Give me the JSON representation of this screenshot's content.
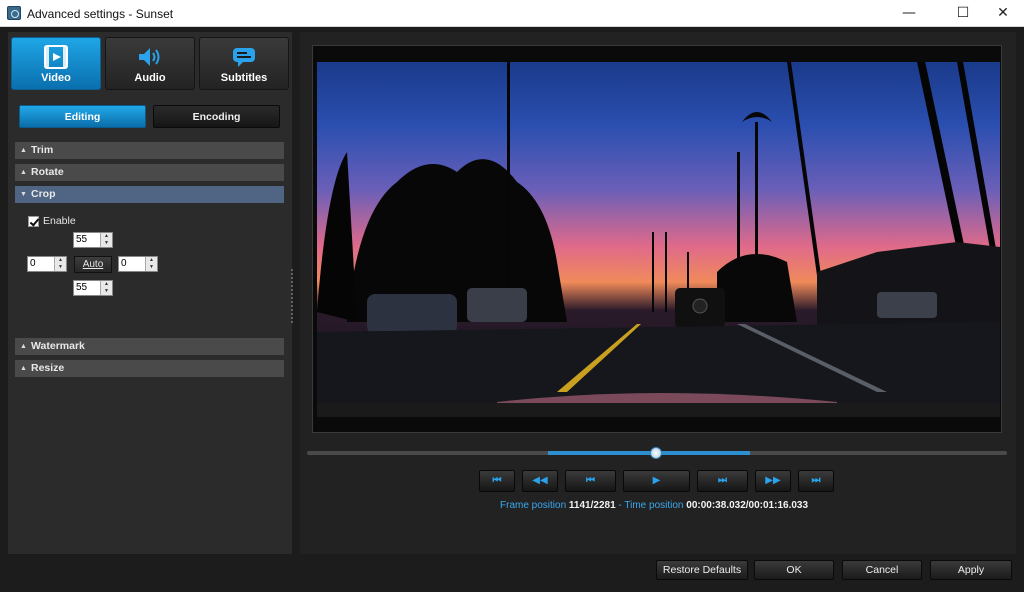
{
  "window": {
    "title": "Advanced settings - Sunset",
    "minimize_glyph": "—",
    "maximize_glyph": "☐",
    "close_glyph": "✕"
  },
  "main_tabs": [
    {
      "label": "Video",
      "icon": "video-icon",
      "active": true
    },
    {
      "label": "Audio",
      "icon": "speaker-icon",
      "active": false
    },
    {
      "label": "Subtitles",
      "icon": "speech-bubble-icon",
      "active": false
    }
  ],
  "sub_tabs": [
    {
      "label": "Editing",
      "active": true
    },
    {
      "label": "Encoding",
      "active": false
    }
  ],
  "sections": {
    "trim": "Trim",
    "rotate": "Rotate",
    "crop": "Crop",
    "watermark": "Watermark",
    "resize": "Resize"
  },
  "crop": {
    "enable_label": "Enable",
    "enabled": true,
    "top": "55",
    "left": "0",
    "right": "0",
    "bottom": "55",
    "auto_label": "Auto"
  },
  "playback_controls": [
    {
      "name": "go-to-start-button",
      "glyph": "⏮"
    },
    {
      "name": "step-back-button",
      "glyph": "◀◀"
    },
    {
      "name": "previous-frame-button",
      "glyph": "⏮"
    },
    {
      "name": "play-button",
      "glyph": "▶"
    },
    {
      "name": "next-frame-button",
      "glyph": "⏭"
    },
    {
      "name": "step-forward-button",
      "glyph": "▶▶"
    },
    {
      "name": "go-to-end-button",
      "glyph": "⏭"
    }
  ],
  "seek": {
    "position": 0.5
  },
  "status": {
    "frame_label": "Frame position",
    "frame_value": "1141/2281",
    "separator": "-",
    "time_label": "Time position",
    "time_value": "00:00:38.032/00:01:16.033"
  },
  "buttons": {
    "restore": "Restore Defaults",
    "ok": "OK",
    "cancel": "Cancel",
    "apply": "Apply"
  },
  "colors": {
    "accent": "#1a96d8",
    "panel": "#2b2b2b",
    "section_open": "#4f6583",
    "status_label": "#3aa8f0"
  }
}
